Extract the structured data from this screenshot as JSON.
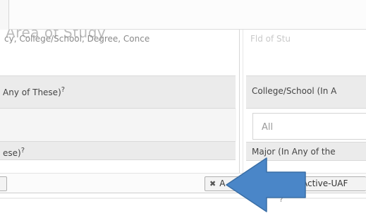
{
  "header": {
    "ghost_title": "Area of Study",
    "subtitle": "cy, College/School, Degree, Conce",
    "right_ghost": "Fld of Stu"
  },
  "left": {
    "any_of_these_label": "Any of These)",
    "hese_label": "ese)",
    "help_mark": "?"
  },
  "right": {
    "college_label": "College/School (In A",
    "college_value": "All",
    "major_label": "Major (In Any of the"
  },
  "chips": {
    "left_edge": "",
    "middle_label": "A",
    "right_label": "Active-UAF"
  },
  "footer": {
    "help_mark": "?"
  },
  "colors": {
    "arrow_fill": "#4a86c8",
    "arrow_stroke": "#3a6ea5"
  }
}
